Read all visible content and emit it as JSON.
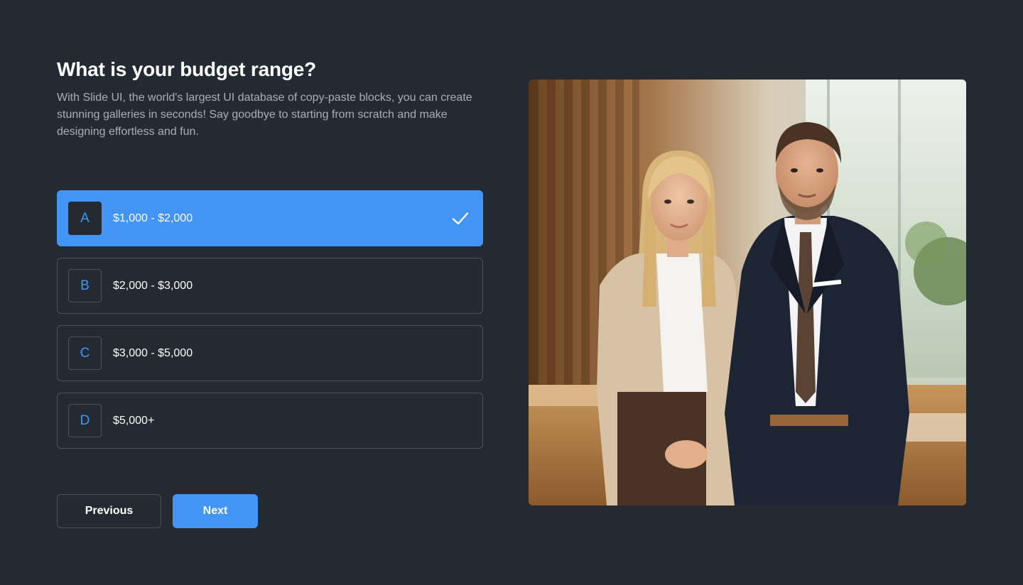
{
  "question": {
    "title": "What is your budget range?",
    "description": "With Slide UI, the world's largest UI database of copy-paste blocks, you can create stunning galleries in seconds! Say goodbye to starting from scratch and make designing effortless and fun."
  },
  "options": [
    {
      "letter": "A",
      "label": "$1,000 - $2,000",
      "selected": true
    },
    {
      "letter": "B",
      "label": "$2,000 - $3,000",
      "selected": false
    },
    {
      "letter": "C",
      "label": "$3,000 - $5,000",
      "selected": false
    },
    {
      "letter": "D",
      "label": "$5,000+",
      "selected": false
    }
  ],
  "buttons": {
    "previous": "Previous",
    "next": "Next"
  },
  "icons": {
    "selected": "checkmark-icon"
  },
  "colors": {
    "background": "#232a31",
    "accent": "#4294f5",
    "border": "#4a525b",
    "muted_text": "#a7afb8"
  }
}
